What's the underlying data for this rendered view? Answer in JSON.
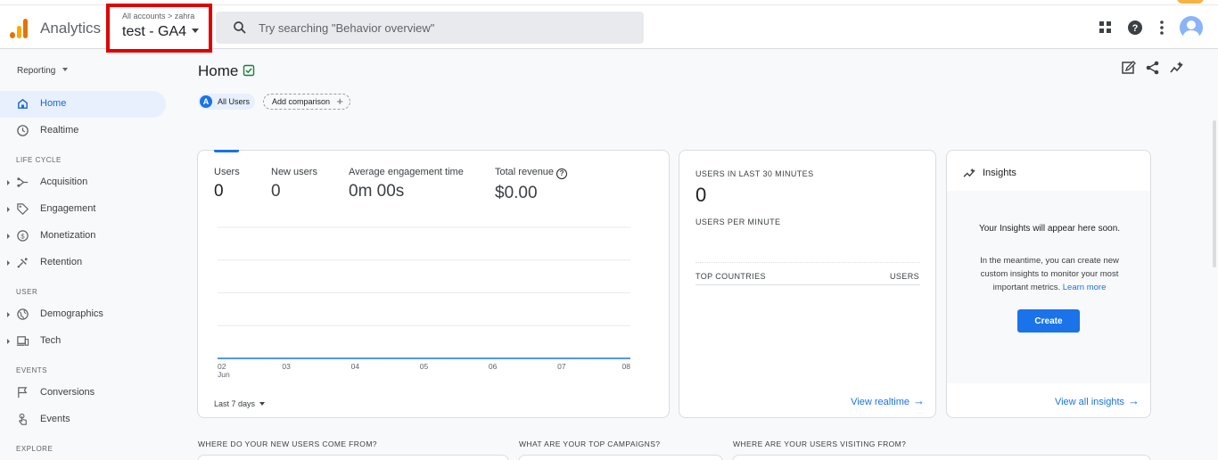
{
  "header": {
    "app_name": "Analytics",
    "breadcrumb": "All accounts > zahra",
    "property": "test - GA4",
    "search_placeholder": "Try searching \"Behavior overview\""
  },
  "sidebar": {
    "reporting_label": "Reporting",
    "home": "Home",
    "realtime": "Realtime",
    "lifecycle_title": "LIFE CYCLE",
    "acquisition": "Acquisition",
    "engagement": "Engagement",
    "monetization": "Monetization",
    "retention": "Retention",
    "user_title": "USER",
    "demographics": "Demographics",
    "tech": "Tech",
    "events_title": "EVENTS",
    "conversions": "Conversions",
    "events": "Events",
    "explore_title": "EXPLORE"
  },
  "page": {
    "title": "Home",
    "all_users_chip": "All Users",
    "all_users_letter": "A",
    "add_comparison": "Add comparison"
  },
  "overview": {
    "metrics": [
      {
        "label": "Users",
        "value": "0"
      },
      {
        "label": "New users",
        "value": "0"
      },
      {
        "label": "Average engagement time",
        "value": "0m 00s"
      },
      {
        "label": "Total revenue",
        "value": "$0.00"
      }
    ],
    "x_ticks": [
      "02",
      "03",
      "04",
      "05",
      "06",
      "07",
      "08"
    ],
    "x_month": "Jun",
    "date_range": "Last 7 days"
  },
  "realtime_card": {
    "users_label": "USERS IN LAST 30 MINUTES",
    "users_value": "0",
    "per_minute_label": "USERS PER MINUTE",
    "countries_label": "TOP COUNTRIES",
    "users_col": "USERS",
    "view_link": "View realtime"
  },
  "insights_card": {
    "title": "Insights",
    "heading": "Your Insights will appear here soon.",
    "body": "In the meantime, you can create new custom insights to monitor your most important metrics.",
    "learn_more": "Learn more",
    "create_button": "Create",
    "view_all": "View all insights"
  },
  "bottom": {
    "q1": "WHERE DO YOUR NEW USERS COME FROM?",
    "q2": "WHAT ARE YOUR TOP CAMPAIGNS?",
    "q3": "WHERE ARE YOUR USERS VISITING FROM?"
  },
  "colors": {
    "brand_blue": "#1a73e8",
    "highlight_red": "#e00000",
    "logo_orange": "#e37400",
    "logo_yellow": "#f9ab00"
  }
}
